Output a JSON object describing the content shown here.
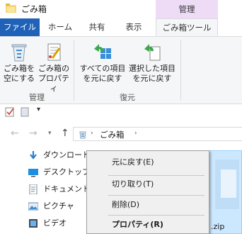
{
  "window": {
    "title": "ごみ箱"
  },
  "ribbon_tabs": {
    "file": "ファイル",
    "home": "ホーム",
    "share": "共有",
    "view": "表示",
    "contextual_header": "管理",
    "recycle_tools": "ごみ箱ツール"
  },
  "ribbon": {
    "empty_bin": [
      "ごみ箱を",
      "空にする"
    ],
    "bin_properties": [
      "ごみ箱の",
      "プロパティ"
    ],
    "restore_all": [
      "すべての項目",
      "を元に戻す"
    ],
    "restore_selected": [
      "選択した項目",
      "を元に戻す"
    ],
    "group_manage": "管理",
    "group_restore": "復元"
  },
  "address": {
    "location": "ごみ箱"
  },
  "nav_pane": {
    "items": [
      {
        "label": "ダウンロード",
        "icon": "download-arrow-icon"
      },
      {
        "label": "デスクトップ",
        "icon": "desktop-icon"
      },
      {
        "label": "ドキュメント",
        "icon": "documents-icon"
      },
      {
        "label": "ピクチャ",
        "icon": "pictures-icon"
      },
      {
        "label": "ビデオ",
        "icon": "videos-icon"
      }
    ]
  },
  "file": {
    "name_fragment": ".zip"
  },
  "context_menu": {
    "items": [
      {
        "label": "元に戻す(E)",
        "bold": false
      },
      {
        "label": "切り取り(T)",
        "bold": false
      },
      {
        "label": "削除(D)",
        "bold": false
      },
      {
        "label": "プロパティ(R)",
        "bold": true
      }
    ]
  },
  "colors": {
    "file_tab": "#1f62b8",
    "contextual": "#eedcf6",
    "ribbon_bg": "#f5f6f7",
    "selection": "#cce8ff"
  }
}
